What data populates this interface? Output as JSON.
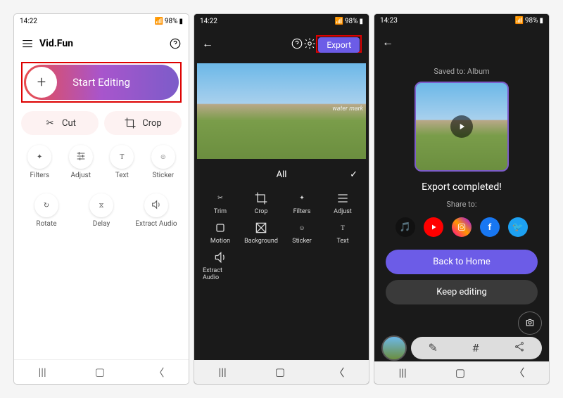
{
  "s1": {
    "time": "14:22",
    "batt": "98%",
    "app": "Vid.Fun",
    "start": "Start Editing",
    "cut": "Cut",
    "crop": "Crop",
    "tools": [
      "Filters",
      "Adjust",
      "Text",
      "Sticker",
      "Rotate",
      "Delay",
      "Extract Audio"
    ]
  },
  "s2": {
    "time": "14:22",
    "batt": "98%",
    "export": "Export",
    "wmark": "water mark",
    "all": "All",
    "tools": [
      "Trim",
      "Crop",
      "Filters",
      "Adjust",
      "Motion",
      "Background",
      "Sticker",
      "Text",
      "Extract Audio"
    ]
  },
  "s3": {
    "time": "14:23",
    "batt": "98%",
    "saved": "Saved to: Album",
    "done": "Export completed!",
    "share": "Share to:",
    "home": "Back to Home",
    "keep": "Keep editing"
  }
}
